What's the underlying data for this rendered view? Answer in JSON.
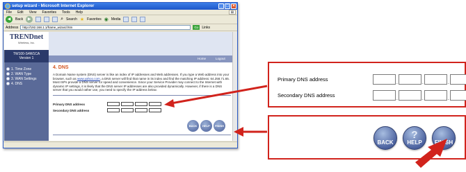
{
  "window": {
    "title": "setup wizard - Microsoft Internet Explorer",
    "menu": [
      "File",
      "Edit",
      "View",
      "Favorites",
      "Tools",
      "Help"
    ],
    "toolbar": {
      "back_label": "Back",
      "search_label": "Search",
      "favorites_label": "Favorites",
      "media_label": "Media"
    },
    "address_label": "Address",
    "address_value": "http://192.168.1.1/frame_wizard.htm",
    "go_label": "Go",
    "links_label": "Links"
  },
  "page": {
    "brand": "TRENDnet",
    "brand_sub": "Wireless, Inc.",
    "model_line1": "TW100-S4W1CA",
    "model_line2": "Version 1",
    "steps": [
      "1. Time Zone",
      "2. WAN Type",
      "3. WAN Settings",
      "4. DNS"
    ],
    "header_buttons": {
      "home": "Home",
      "logout": "Logout"
    },
    "section_title": "4. DNS",
    "description_pre": "A Domain Name system (DNS) server is like an index of IP addresses and Web addresses. If you type a Web address into your browser, such as ",
    "description_link": "www.yahoo.com",
    "description_post": ", a DNS server will find that name in its index and find the matching IP address: 64.258.71.65.",
    "description_2": "Most ISPs provide a DNS server for speed and convenience. Since your Service Provider may connect to the Internet with dynamic IP settings, it is likely that the DNS server IP addresses are also provided dynamically. However, if there is a DNS server that you would rather use, you need to specify the IP address below.",
    "primary_label": "Primary DNS address",
    "secondary_label": "Secondary DNS address",
    "buttons": {
      "back": "BACK",
      "help": "HELP",
      "finish": "FINISH"
    }
  },
  "zoom": {
    "primary_label": "Primary DNS address",
    "secondary_label": "Secondary DNS address",
    "buttons": {
      "back": "BACK",
      "help": "HELP",
      "finish": "FINISH"
    }
  },
  "colors": {
    "highlight": "#d1231c",
    "accent": "#d3541f",
    "sidebar": "#5a6a98"
  }
}
